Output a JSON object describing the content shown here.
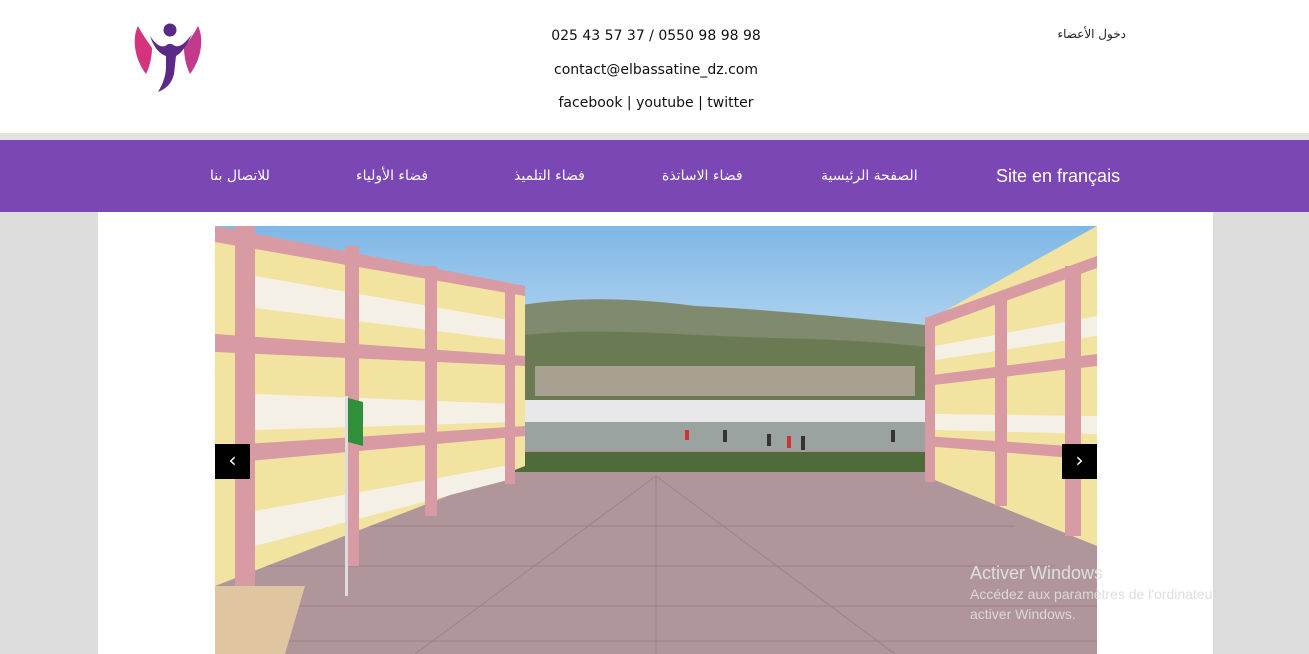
{
  "header": {
    "phones": "025 43 57 37 / 0550 98 98 98",
    "email": "contact@elbassatine_dz.com",
    "social": {
      "facebook": "facebook",
      "youtube": "youtube",
      "twitter": "twitter",
      "separator": "|"
    },
    "member_login": "دخول الأعضاء"
  },
  "nav": {
    "items": [
      {
        "label": "للاتصال بنا"
      },
      {
        "label": "فضاء الأولياء"
      },
      {
        "label": "فضاء التلميذ"
      },
      {
        "label": "فضاء الاساتذة"
      },
      {
        "label": "الصفحة الرئيسية"
      },
      {
        "label": "Site en français"
      }
    ]
  },
  "slider": {
    "prev_glyph": "‹",
    "next_glyph": "›"
  },
  "watermark": {
    "title": "Activer Windows",
    "line1": "Accédez aux paramètres de l'ordinateur pour",
    "line2": "activer Windows."
  },
  "colors": {
    "nav_bg": "#7a47b4",
    "page_bg": "#dcdcdc",
    "logo_purple": "#5b2a86",
    "logo_pink": "#d6337f"
  },
  "icons": {
    "logo": "person-arms-up-logo",
    "prev": "chevron-left-icon",
    "next": "chevron-right-icon"
  }
}
